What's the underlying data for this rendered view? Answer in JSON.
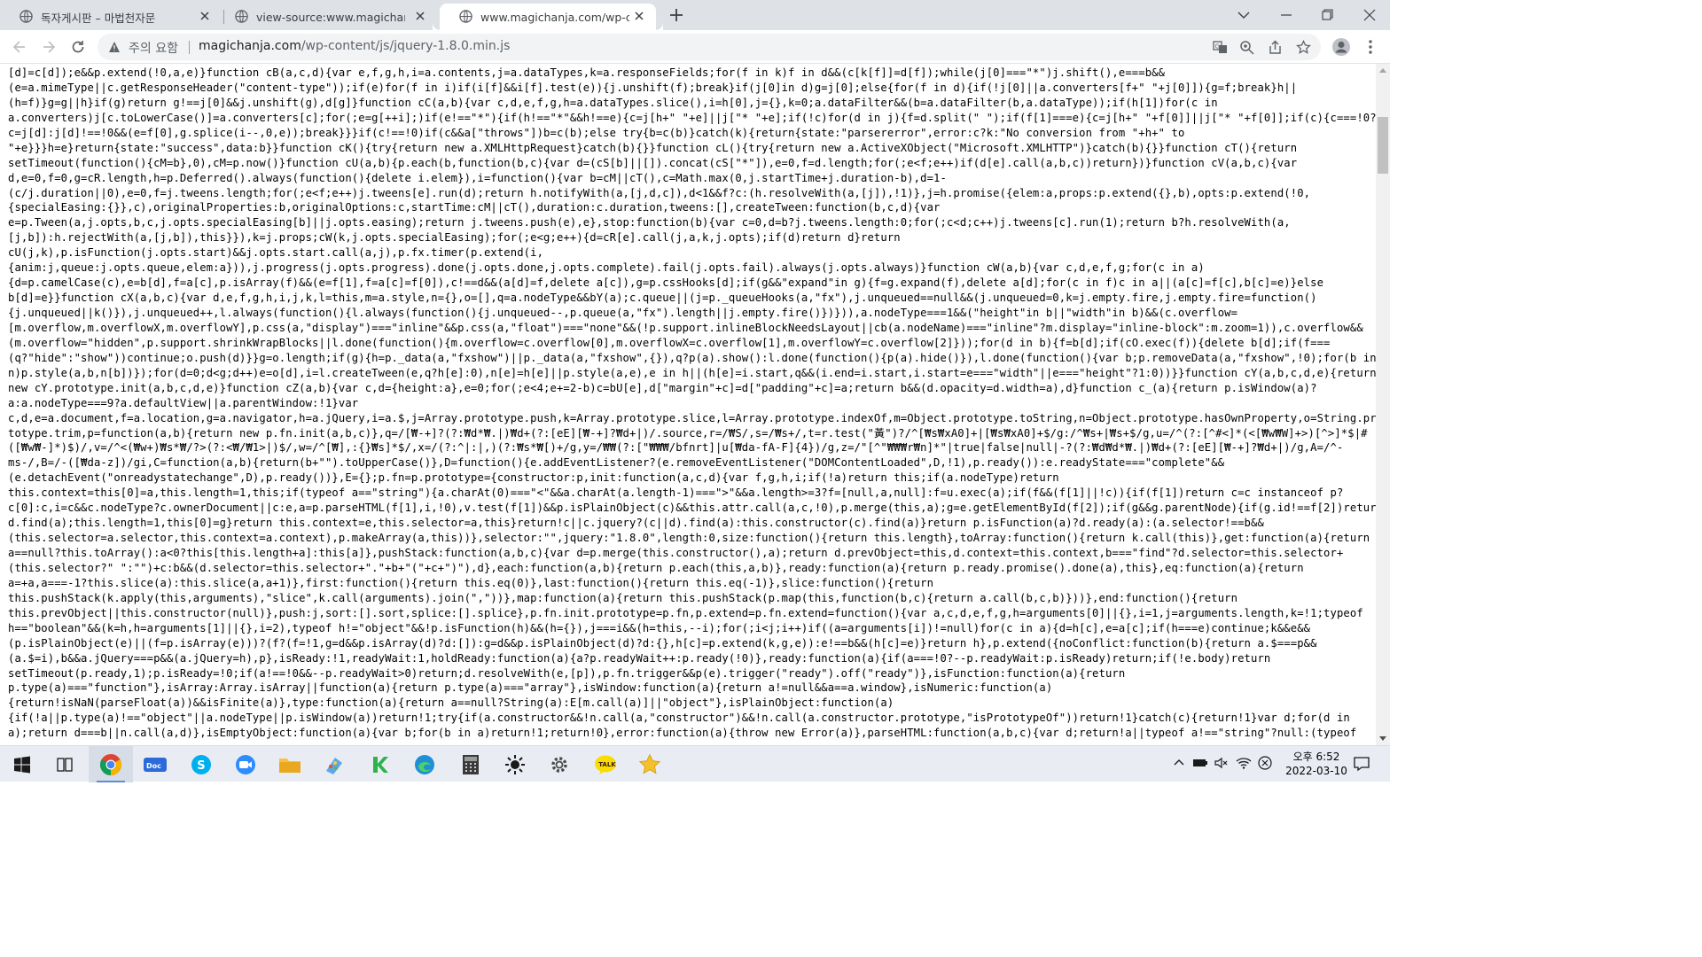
{
  "browser": {
    "tabs": [
      {
        "title": "독자게시판 – 마법천자문",
        "active": false
      },
      {
        "title": "view-source:www.magichanja.co",
        "active": false
      },
      {
        "title": "www.magichanja.com/wp-conte",
        "active": true
      }
    ],
    "omnibox": {
      "security_label": "주의 요함",
      "url_host": "magichanja.com",
      "url_path": "/wp-content/js/jquery-1.8.0.min.js"
    },
    "icons": {
      "tab_favicon": "globe-icon",
      "tab_close": "close-icon",
      "new_tab": "plus-icon",
      "back": "back-arrow-icon",
      "forward": "forward-arrow-icon",
      "reload": "reload-icon",
      "warning": "warning-triangle-icon",
      "translate": "translate-icon",
      "zoom": "zoom-icon",
      "share": "share-icon",
      "bookmark": "star-icon",
      "profile": "profile-icon",
      "menu": "kebab-menu-icon"
    }
  },
  "source_lines": [
    "[d]=c[d]);e&&p.extend(!0,a,e)}function cB(a,c,d){var e,f,g,h,i=a.contents,j=a.dataTypes,k=a.responseFields;for(f in k)f in d&&(c[k[f]]=d[f]);while(j[0]===\"*\")j.shift(),e===b&&",
    "(e=a.mimeType||c.getResponseHeader(\"content-type\"));if(e)for(f in i)if(i[f]&&i[f].test(e)){j.unshift(f);break}if(j[0]in d)g=j[0];else{for(f in d){if(!j[0]||a.converters[f+\" \"+j[0]]){g=f;break}h||",
    "(h=f)}g=g||h}if(g)return g!==j[0]&&j.unshift(g),d[g]}function cC(a,b){var c,d,e,f,g,h=a.dataTypes.slice(),i=h[0],j={},k=0;a.dataFilter&&(b=a.dataFilter(b,a.dataType));if(h[1])for(c in",
    "a.converters)j[c.toLowerCase()]=a.converters[c];for(;e=g[++i];)if(e!==\"*\"){if(h!==\"*\"&&h!==e){c=j[h+\" \"+e]||j[\"* \"+e];if(!c)for(d in j){f=d.split(\" \");if(f[1]===e){c=j[h+\" \"+f[0]]||j[\"* \"+f[0]];if(c){c===!0?",
    "c=j[d]:j[d]!==!0&&(e=f[0],g.splice(i--,0,e));break}}}if(c!==!0)if(c&&a[\"throws\"])b=c(b);else try{b=c(b)}catch(k){return{state:\"parsererror\",error:c?k:\"No conversion from \"+h+\" to",
    "\"+e}}}h=e}return{state:\"success\",data:b}}function cK(){try{return new a.XMLHttpRequest}catch(b){}}function cL(){try{return new a.ActiveXObject(\"Microsoft.XMLHTTP\")}catch(b){}}function cT(){return",
    "setTimeout(function(){cM=b},0),cM=p.now()}function cU(a,b){p.each(b,function(b,c){var d=(cS[b]||[]).concat(cS[\"*\"]),e=0,f=d.length;for(;e<f;e++)if(d[e].call(a,b,c))return})}function cV(a,b,c){var",
    "d,e=0,f=0,g=cR.length,h=p.Deferred().always(function(){delete i.elem}),i=function(){var b=cM||cT(),c=Math.max(0,j.startTime+j.duration-b),d=1-",
    "(c/j.duration||0),e=0,f=j.tweens.length;for(;e<f;e++)j.tweens[e].run(d);return h.notifyWith(a,[j,d,c]),d<1&&f?c:(h.resolveWith(a,[j]),!1)},j=h.promise({elem:a,props:p.extend({},b),opts:p.extend(!0,",
    "{specialEasing:{}},c),originalProperties:b,originalOptions:c,startTime:cM||cT(),duration:c.duration,tweens:[],createTween:function(b,c,d){var",
    "e=p.Tween(a,j.opts,b,c,j.opts.specialEasing[b]||j.opts.easing);return j.tweens.push(e),e},stop:function(b){var c=0,d=b?j.tweens.length:0;for(;c<d;c++)j.tweens[c].run(1);return b?h.resolveWith(a,",
    "[j,b]):h.rejectWith(a,[j,b]),this}}),k=j.props;cW(k,j.opts.specialEasing);for(;e<g;e++){d=cR[e].call(j,a,k,j.opts);if(d)return d}return",
    "cU(j,k),p.isFunction(j.opts.start)&&j.opts.start.call(a,j),p.fx.timer(p.extend(i,",
    "{anim:j,queue:j.opts.queue,elem:a})),j.progress(j.opts.progress).done(j.opts.done,j.opts.complete).fail(j.opts.fail).always(j.opts.always)}function cW(a,b){var c,d,e,f,g;for(c in a)",
    "{d=p.camelCase(c),e=b[d],f=a[c],p.isArray(f)&&(e=f[1],f=a[c]=f[0]),c!==d&&(a[d]=f,delete a[c]),g=p.cssHooks[d];if(g&&\"expand\"in g){f=g.expand(f),delete a[d];for(c in f)c in a||(a[c]=f[c],b[c]=e)}else",
    "b[d]=e}}function cX(a,b,c){var d,e,f,g,h,i,j,k,l=this,m=a.style,n={},o=[],q=a.nodeType&&bY(a);c.queue||(j=p._queueHooks(a,\"fx\"),j.unqueued==null&&(j.unqueued=0,k=j.empty.fire,j.empty.fire=function()",
    "{j.unqueued||k()}),j.unqueued++,l.always(function(){l.always(function(){j.unqueued--,p.queue(a,\"fx\").length||j.empty.fire()})})),a.nodeType===1&&(\"height\"in b||\"width\"in b)&&(c.overflow=",
    "[m.overflow,m.overflowX,m.overflowY],p.css(a,\"display\")===\"inline\"&&p.css(a,\"float\")===\"none\"&&(!p.support.inlineBlockNeedsLayout||cb(a.nodeName)===\"inline\"?m.display=\"inline-block\":m.zoom=1)),c.overflow&&",
    "(m.overflow=\"hidden\",p.support.shrinkWrapBlocks||l.done(function(){m.overflow=c.overflow[0],m.overflowX=c.overflow[1],m.overflowY=c.overflow[2]}));for(d in b){f=b[d];if(cO.exec(f)){delete b[d];if(f===",
    "(q?\"hide\":\"show\"))continue;o.push(d)}}g=o.length;if(g){h=p._data(a,\"fxshow\")||p._data(a,\"fxshow\",{}),q?p(a).show():l.done(function(){p(a).hide()}),l.done(function(){var b;p.removeData(a,\"fxshow\",!0);for(b in",
    "n)p.style(a,b,n[b])});for(d=0;d<g;d++)e=o[d],i=l.createTween(e,q?h[e]:0),n[e]=h[e]||p.style(a,e),e in h||(h[e]=i.start,q&&(i.end=i.start,i.start=e===\"width\"||e===\"height\"?1:0))}}function cY(a,b,c,d,e){return",
    "new cY.prototype.init(a,b,c,d,e)}function cZ(a,b){var c,d={height:a},e=0;for(;e<4;e+=2-b)c=bU[e],d[\"margin\"+c]=d[\"padding\"+c]=a;return b&&(d.opacity=d.width=a),d}function c_(a){return p.isWindow(a)?",
    "a:a.nodeType===9?a.defaultView||a.parentWindow:!1}var",
    "c,d,e=a.document,f=a.location,g=a.navigator,h=a.jQuery,i=a.$,j=Array.prototype.push,k=Array.prototype.slice,l=Array.prototype.indexOf,m=Object.prototype.toString,n=Object.prototype.hasOwnProperty,o=String.pro",
    "totype.trim,p=function(a,b){return new p.fn.init(a,b,c)},q=/[₩-+]?(?:₩d*₩.|)₩d+(?:[eE][₩-+]?₩d+|)/.source,r=/₩S/,s=/₩s+/,t=r.test(\"黃\")?/^[₩s₩xA0]+|[₩s₩xA0]+$/g:/^₩s+|₩s+$/g,u=/^(?:[^#<]*(<[₩w₩W]+>)[^>]*$|#",
    "([₩w₩-]*)$)/,v=/^<(₩w+)₩s*₩/?>(?:<₩/₩1>|)$/,w=/^[₩],:{}₩s]*$/,x=/(?:^|:|,)(?:₩s*₩[)+/g,y=/₩₩(?:[\"₩₩₩/bfnrt]|u[₩da-fA-F]{4})/g,z=/\"[^\"₩₩₩r₩n]*\"|true|false|null|-?(?:₩d₩d*₩.|)₩d+(?:[eE][₩-+]?₩d+|)/g,A=/^-",
    "ms-/,B=/-([₩da-z])/gi,C=function(a,b){return(b+\"\").toUpperCase()},D=function(){e.addEventListener?(e.removeEventListener(\"DOMContentLoaded\",D,!1),p.ready()):e.readyState===\"complete\"&&",
    "(e.detachEvent(\"onreadystatechange\",D),p.ready())},E={};p.fn=p.prototype={constructor:p,init:function(a,c,d){var f,g,h,i;if(!a)return this;if(a.nodeType)return",
    "this.context=this[0]=a,this.length=1,this;if(typeof a==\"string\"){a.charAt(0)===\"<\"&&a.charAt(a.length-1)===\">\"&&a.length>=3?f=[null,a,null]:f=u.exec(a);if(f&&(f[1]||!c)){if(f[1])return c=c instanceof p?",
    "c[0]:c,i=c&&c.nodeType?c.ownerDocument||c:e,a=p.parseHTML(f[1],i,!0),v.test(f[1])&&p.isPlainObject(c)&&this.attr.call(a,c,!0),p.merge(this,a);g=e.getElementById(f[2]);if(g&&g.parentNode){if(g.id!==f[2])return",
    "d.find(a);this.length=1,this[0]=g}return this.context=e,this.selector=a,this}return!c||c.jquery?(c||d).find(a):this.constructor(c).find(a)}return p.isFunction(a)?d.ready(a):(a.selector!==b&&",
    "(this.selector=a.selector,this.context=a.context),p.makeArray(a,this))},selector:\"\",jquery:\"1.8.0\",length:0,size:function(){return this.length},toArray:function(){return k.call(this)},get:function(a){return",
    "a==null?this.toArray():a<0?this[this.length+a]:this[a]},pushStack:function(a,b,c){var d=p.merge(this.constructor(),a);return d.prevObject=this,d.context=this.context,b===\"find\"?d.selector=this.selector+",
    "(this.selector?\" \":\"\")+c:b&&(d.selector=this.selector+\".\"+b+\"(\"+c+\")\"),d},each:function(a,b){return p.each(this,a,b)},ready:function(a){return p.ready.promise().done(a),this},eq:function(a){return",
    "a=+a,a===-1?this.slice(a):this.slice(a,a+1)},first:function(){return this.eq(0)},last:function(){return this.eq(-1)},slice:function(){return",
    "this.pushStack(k.apply(this,arguments),\"slice\",k.call(arguments).join(\",\"))},map:function(a){return this.pushStack(p.map(this,function(b,c){return a.call(b,c,b)}))},end:function(){return",
    "this.prevObject||this.constructor(null)},push:j,sort:[].sort,splice:[].splice},p.fn.init.prototype=p.fn,p.extend=p.fn.extend=function(){var a,c,d,e,f,g,h=arguments[0]||{},i=1,j=arguments.length,k=!1;typeof",
    "h==\"boolean\"&&(k=h,h=arguments[1]||{},i=2),typeof h!=\"object\"&&!p.isFunction(h)&&(h={}),j===i&&(h=this,--i);for(;i<j;i++)if((a=arguments[i])!=null)for(c in a){d=h[c],e=a[c];if(h===e)continue;k&&e&&",
    "(p.isPlainObject(e)||(f=p.isArray(e)))?(f?(f=!1,g=d&&p.isArray(d)?d:[]):g=d&&p.isPlainObject(d)?d:{},h[c]=p.extend(k,g,e)):e!==b&&(h[c]=e)}return h},p.extend({noConflict:function(b){return a.$===p&&",
    "(a.$=i),b&&a.jQuery===p&&(a.jQuery=h),p},isReady:!1,readyWait:1,holdReady:function(a){a?p.readyWait++:p.ready(!0)},ready:function(a){if(a===!0?--p.readyWait:p.isReady)return;if(!e.body)return",
    "setTimeout(p.ready,1);p.isReady=!0;if(a!==!0&&--p.readyWait>0)return;d.resolveWith(e,[p]),p.fn.trigger&&p(e).trigger(\"ready\").off(\"ready\")},isFunction:function(a){return",
    "p.type(a)===\"function\"},isArray:Array.isArray||function(a){return p.type(a)===\"array\"},isWindow:function(a){return a!=null&&a==a.window},isNumeric:function(a)",
    "{return!isNaN(parseFloat(a))&&isFinite(a)},type:function(a){return a==null?String(a):E[m.call(a)]||\"object\"},isPlainObject:function(a)",
    "{if(!a||p.type(a)!==\"object\"||a.nodeType||p.isWindow(a))return!1;try{if(a.constructor&&!n.call(a,\"constructor\")&&!n.call(a.constructor.prototype,\"isPrototypeOf\"))return!1}catch(c){return!1}var d;for(d in",
    "a);return d===b||n.call(a,d)},isEmptyObject:function(a){var b;for(b in a)return!1;return!0},error:function(a){throw new Error(a)},parseHTML:function(a,b,c){var d;return!a||typeof a!==\"string\"?null:(typeof"
  ],
  "taskbar": {
    "items": [
      {
        "name": "start-button",
        "icon": "windows-logo-icon"
      },
      {
        "name": "task-view-button",
        "icon": "task-view-icon"
      },
      {
        "name": "chrome-app",
        "icon": "chrome-icon"
      },
      {
        "name": "word-app",
        "icon": "word-icon"
      },
      {
        "name": "skype-app",
        "icon": "skype-icon"
      },
      {
        "name": "zoom-app",
        "icon": "zoom-icon"
      },
      {
        "name": "file-explorer-app",
        "icon": "folder-icon"
      },
      {
        "name": "paint-app",
        "icon": "paint-icon"
      },
      {
        "name": "kiwoom-app",
        "icon": "k-icon"
      },
      {
        "name": "edge-app",
        "icon": "edge-icon"
      },
      {
        "name": "calculator-app",
        "icon": "calculator-icon"
      },
      {
        "name": "brightness-app",
        "icon": "sun-icon"
      },
      {
        "name": "settings-app",
        "icon": "gear-icon"
      },
      {
        "name": "kakaotalk-app",
        "icon": "kakaotalk-icon"
      },
      {
        "name": "favorites-app",
        "icon": "star-icon"
      }
    ],
    "clock": {
      "time": "오후 6:52",
      "date": "2022-03-10"
    },
    "tray_icons": [
      "chevron-up-icon",
      "battery-icon",
      "volume-mute-icon",
      "wifi-icon",
      "ime-icon",
      "notification-icon"
    ]
  }
}
